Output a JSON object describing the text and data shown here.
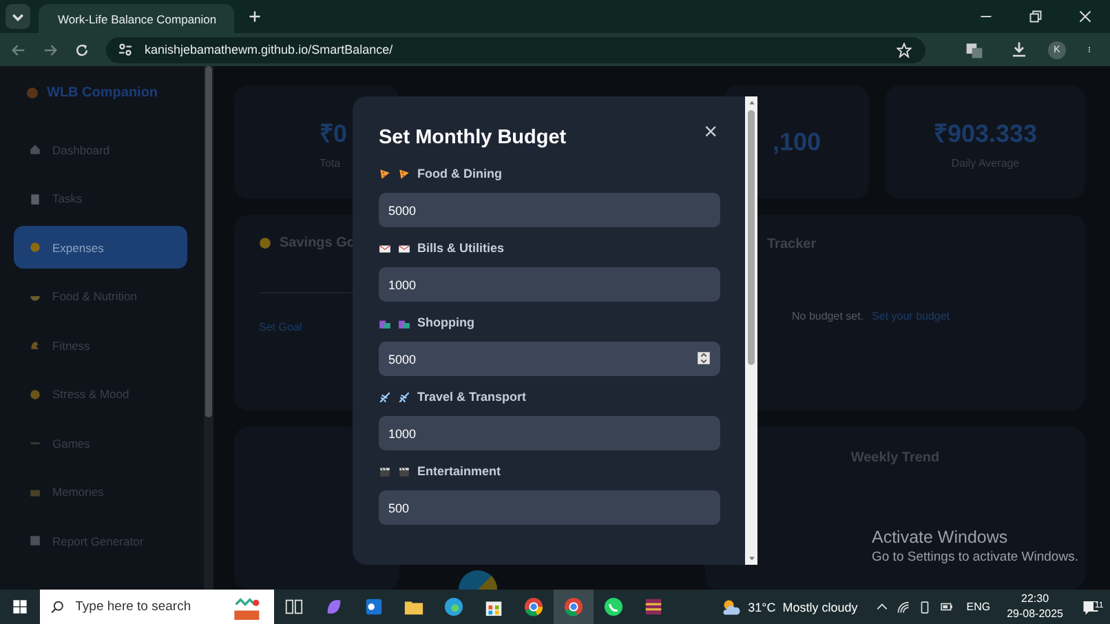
{
  "browser": {
    "tabs": [
      {
        "title": "Work-Life Balance Companion",
        "selected": true
      }
    ],
    "address": "kanishjebamathewm.github.io/SmartBalance/",
    "profile": "K"
  },
  "sidebar": {
    "brand": "WLB Companion",
    "items": [
      {
        "label": "Dashboard",
        "selected": false
      },
      {
        "label": "Tasks",
        "selected": false
      },
      {
        "label": "Expenses",
        "selected": true
      },
      {
        "label": "Food & Nutrition",
        "selected": false
      },
      {
        "label": "Fitness",
        "selected": false
      },
      {
        "label": "Stress & Mood",
        "selected": false
      },
      {
        "label": "Games",
        "selected": false
      },
      {
        "label": "Memories",
        "selected": false
      },
      {
        "label": "Report Generator",
        "selected": false
      }
    ]
  },
  "stats": [
    {
      "value": "₹0",
      "label": "Tota"
    },
    {
      "value": ",100"
    },
    {
      "value": "₹903.333",
      "label": "Daily Average"
    }
  ],
  "savings": {
    "title": "Savings Go",
    "link": "Set Goal"
  },
  "tracker": {
    "title": "Tracker",
    "message": "No budget set.",
    "link": "Set your budget"
  },
  "trend": {
    "title": "Weekly Trend"
  },
  "modal": {
    "title": "Set Monthly Budget",
    "close": "×",
    "fields": [
      {
        "label": "Food & Dining",
        "value": "5000",
        "hovered": false
      },
      {
        "label": "Bills & Utilities",
        "value": "1000",
        "hovered": false
      },
      {
        "label": "Shopping",
        "value": "5000",
        "hovered": true
      },
      {
        "label": "Travel & Transport",
        "value": "1000",
        "hovered": false
      },
      {
        "label": "Entertainment",
        "value": "500",
        "hovered": false
      }
    ]
  },
  "watermark": {
    "title": "Activate Windows",
    "subtitle": "Go to Settings to activate Windows."
  },
  "taskbar": {
    "search_placeholder": "Type here to search",
    "weather": "31°C  Mostly cloudy",
    "language": "ENG",
    "time": "22:30",
    "date": "29-08-2025",
    "notifications": "11"
  }
}
